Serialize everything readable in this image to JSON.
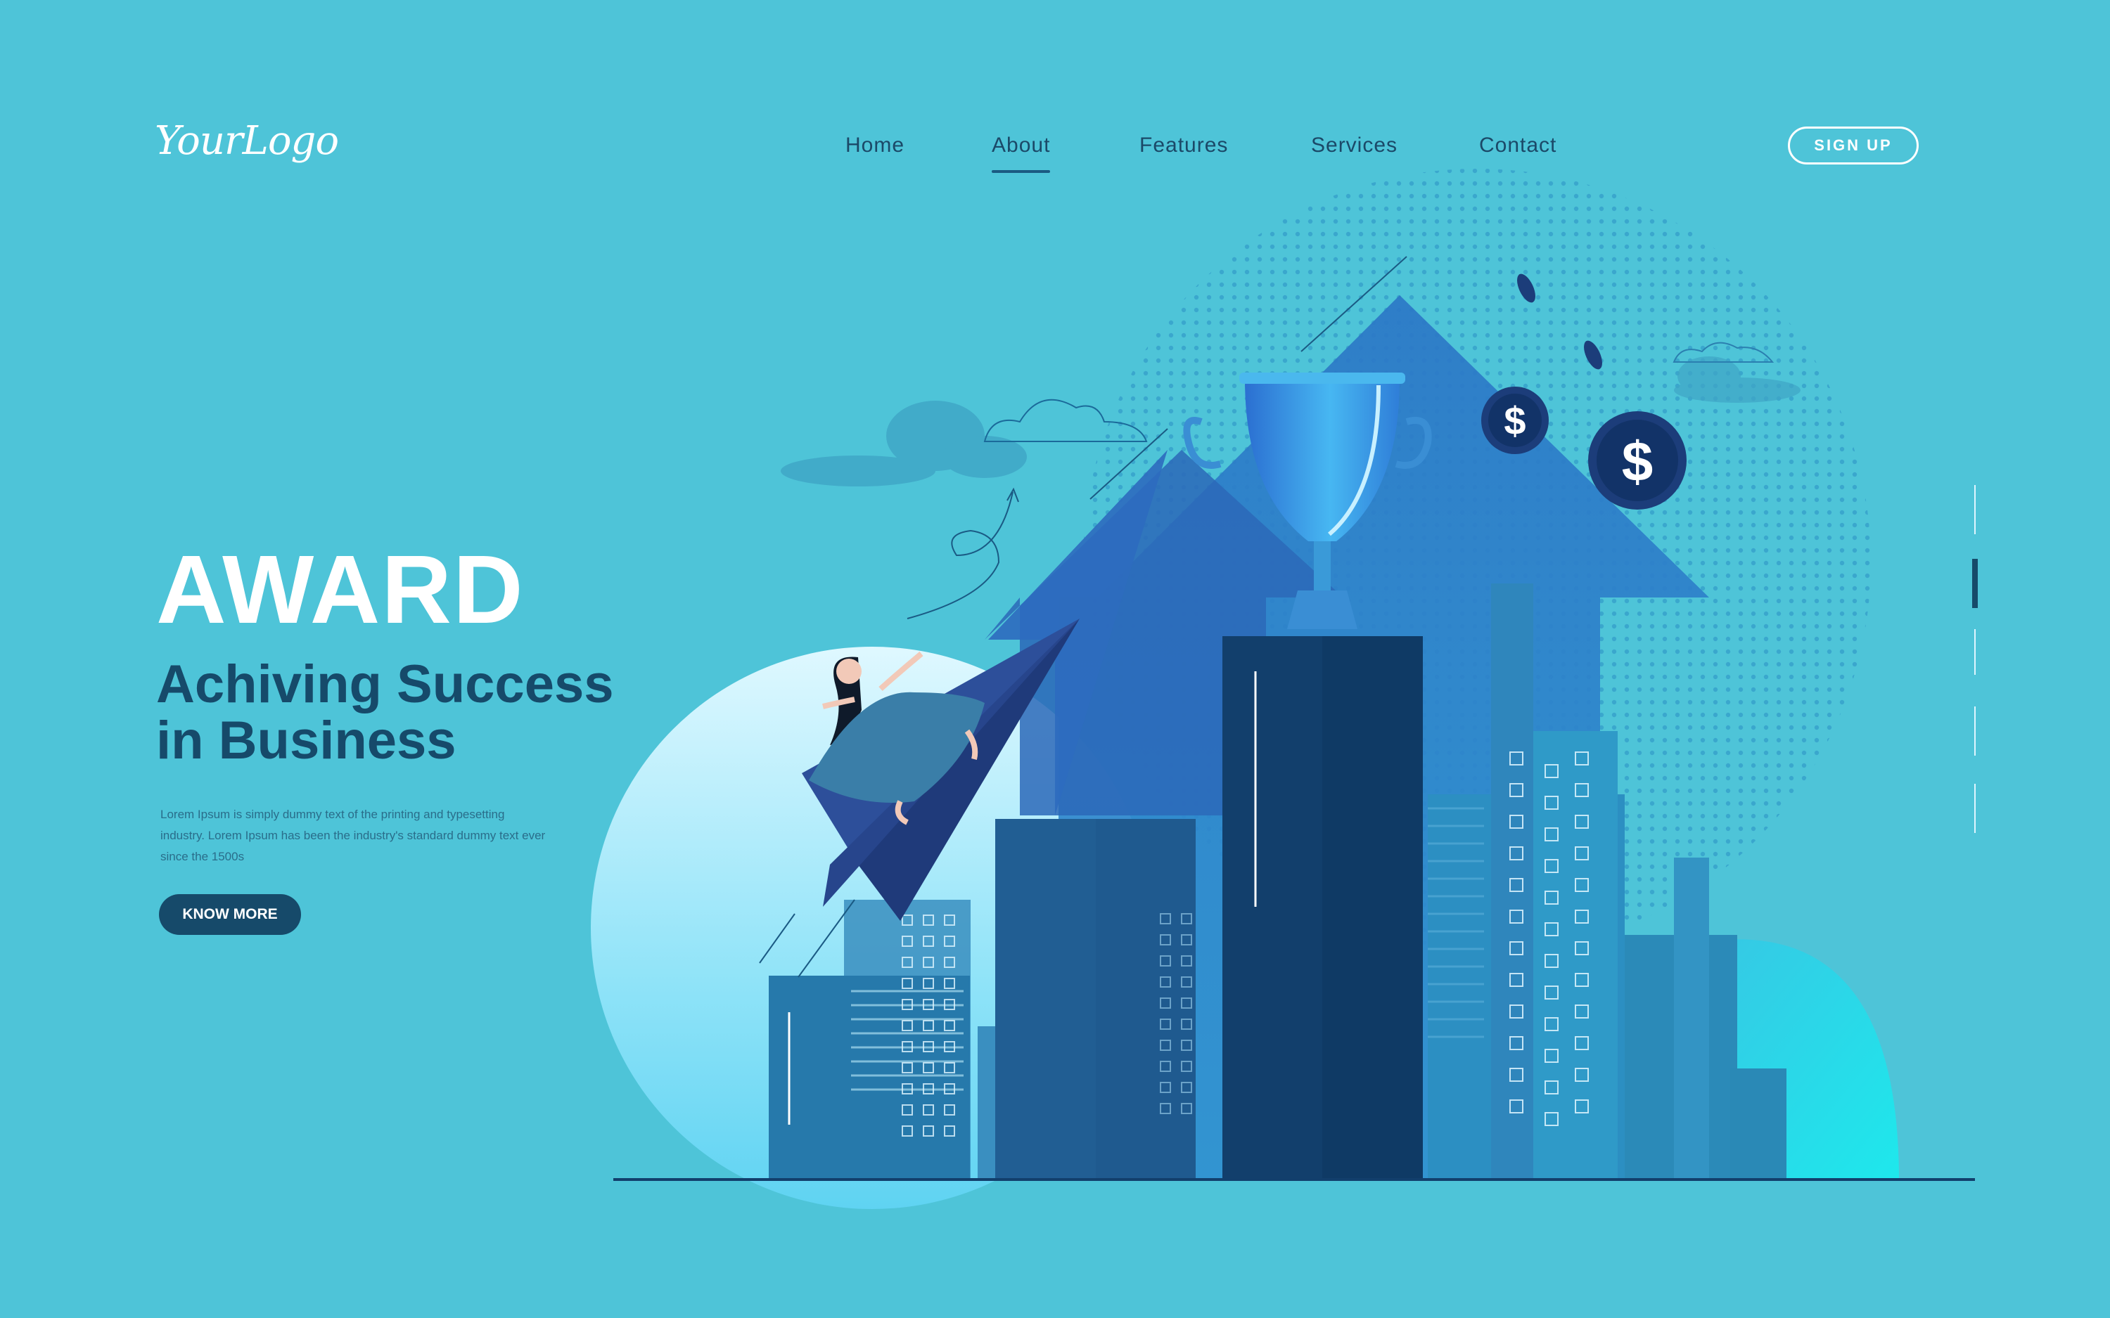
{
  "logo": {
    "text": "YourLogo"
  },
  "nav": {
    "items": [
      {
        "label": "Home"
      },
      {
        "label": "About"
      },
      {
        "label": "Features"
      },
      {
        "label": "Services"
      },
      {
        "label": "Contact"
      }
    ],
    "active_index": 1
  },
  "header": {
    "signup_label": "SIGN UP"
  },
  "hero": {
    "title": "AWARD",
    "subtitle_line1": "Achiving Success",
    "subtitle_line2": "in Business",
    "body_line1": "Lorem Ipsum is simply dummy text of the printing and typesetting",
    "body_line2": "industry. Lorem Ipsum has been the industry's standard dummy text ever",
    "body_line3": "since the 1500s",
    "cta_label": "KNOW MORE"
  },
  "illustration": {
    "coin_symbol": "$",
    "icons": [
      "trophy-icon",
      "dollar-coin-icon",
      "paper-plane-icon",
      "up-arrow-icon",
      "cloud-icon",
      "city-buildings-icon",
      "woman-figure-icon"
    ]
  },
  "colors": {
    "background": "#4ec4d8",
    "accent_dark": "#164a6a",
    "nav_text": "#1b4968",
    "white": "#ffffff"
  }
}
